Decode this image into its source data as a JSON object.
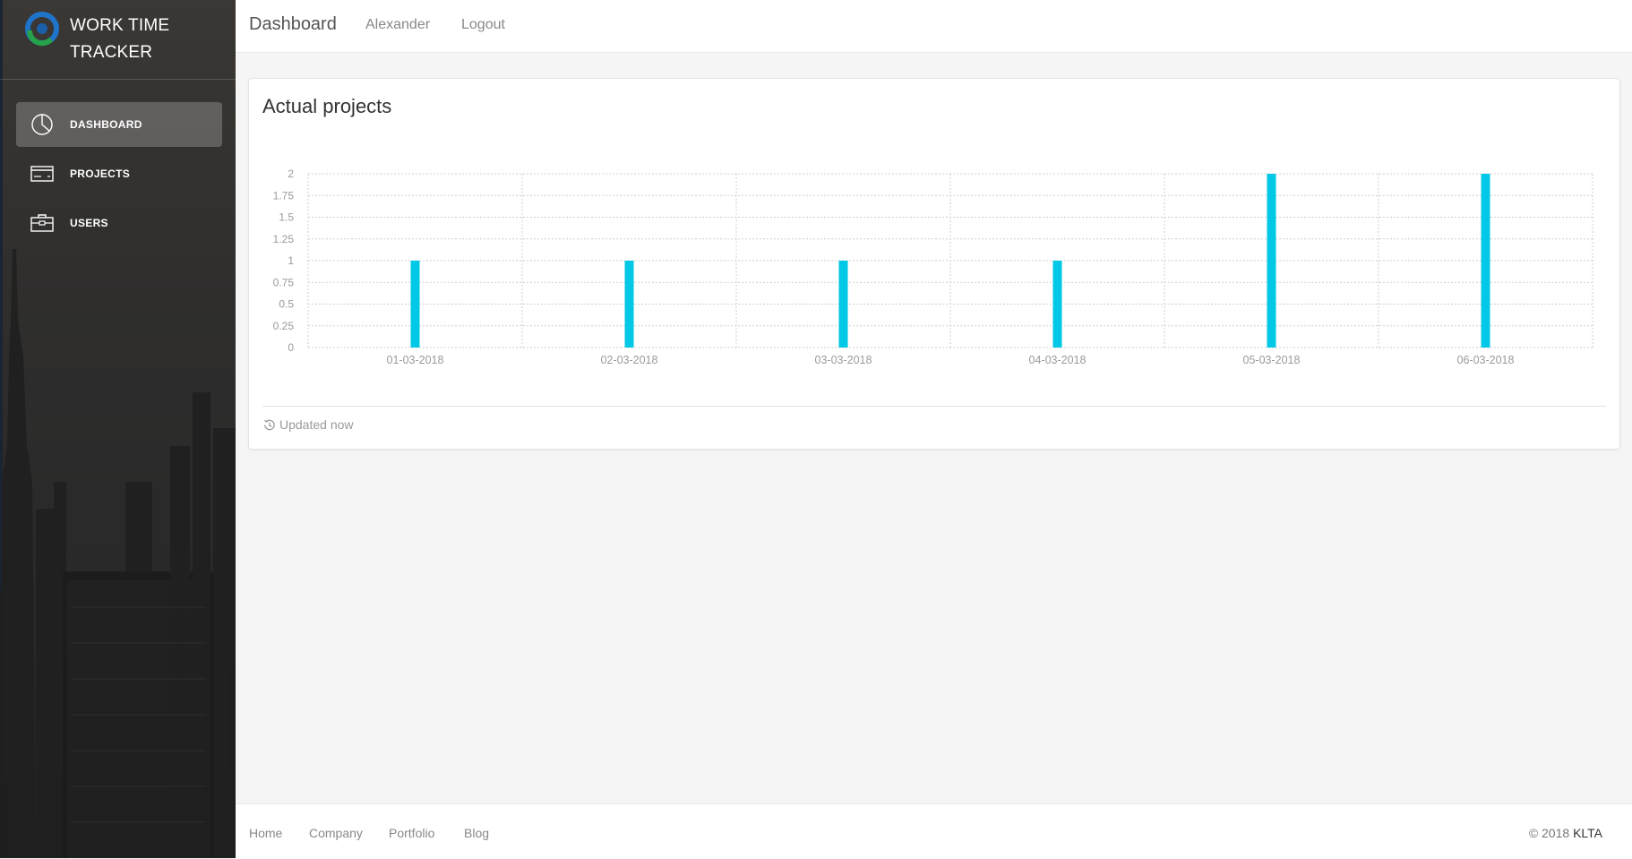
{
  "app": {
    "brand_line1": "WORK TIME",
    "brand_line2": "TRACKER"
  },
  "sidebar": {
    "items": [
      {
        "label": "DASHBOARD",
        "icon": "pie-chart-icon",
        "active": true
      },
      {
        "label": "PROJECTS",
        "icon": "credit-card-icon",
        "active": false
      },
      {
        "label": "USERS",
        "icon": "briefcase-icon",
        "active": false
      }
    ]
  },
  "header": {
    "title": "Dashboard",
    "user": "Alexander",
    "logout": "Logout"
  },
  "card": {
    "title": "Actual projects",
    "footer_text": "Updated now"
  },
  "colors": {
    "bar": "#00c8e6",
    "grid": "#cfcfcf",
    "axis_text": "#9a9a9a"
  },
  "chart_data": {
    "type": "bar",
    "categories": [
      "01-03-2018",
      "02-03-2018",
      "03-03-2018",
      "04-03-2018",
      "05-03-2018",
      "06-03-2018"
    ],
    "values": [
      1,
      1,
      1,
      1,
      2,
      2
    ],
    "ylim": [
      0,
      2
    ],
    "yticks": [
      "0",
      "0.25",
      "0.5",
      "0.75",
      "1",
      "1.25",
      "1.5",
      "1.75",
      "2"
    ],
    "grid": true,
    "title": "",
    "xlabel": "",
    "ylabel": ""
  },
  "footer": {
    "links": [
      "Home",
      "Company",
      "Portfolio",
      "Blog"
    ],
    "copyright_prefix": "© 2018",
    "copyright_brand": "KLTA"
  }
}
